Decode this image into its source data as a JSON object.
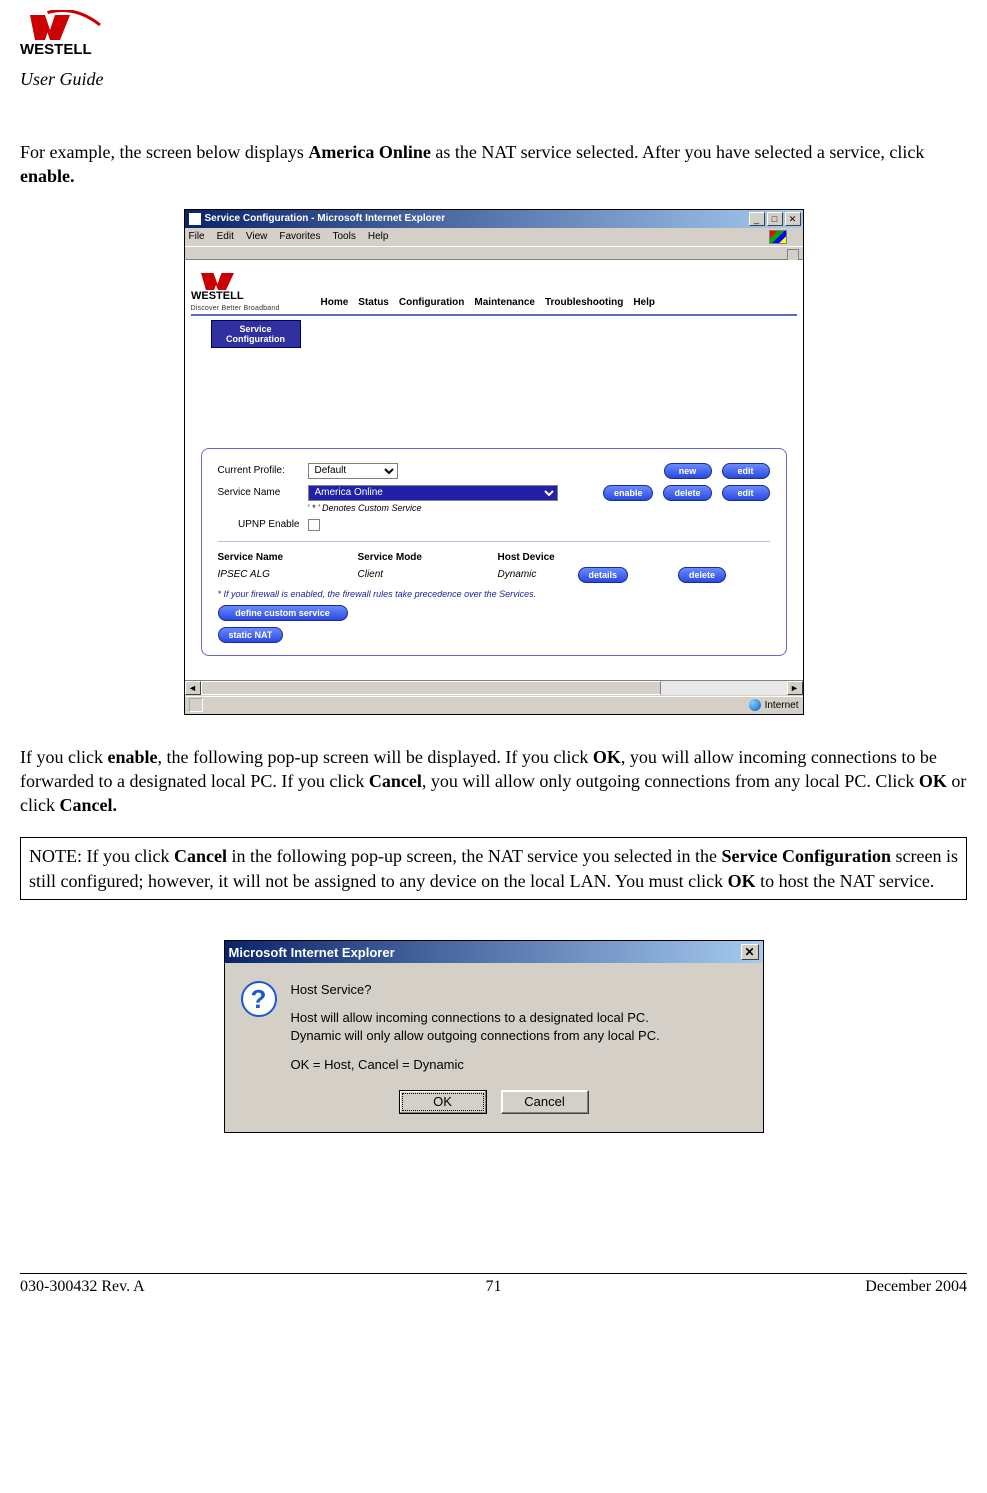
{
  "header": {
    "brand": "WESTELL",
    "user_guide": "User Guide"
  },
  "para1": {
    "pre": "For example, the screen below displays ",
    "b1": "America Online",
    "mid": " as the NAT service selected. After you have selected a service, click ",
    "b2": "enable."
  },
  "app": {
    "title": "Service Configuration - Microsoft Internet Explorer",
    "menu": {
      "file": "File",
      "edit": "Edit",
      "view": "View",
      "favorites": "Favorites",
      "tools": "Tools",
      "help": "Help"
    },
    "brand": "WESTELL",
    "tagline": "Discover Better Broadband",
    "nav": {
      "home": "Home",
      "status": "Status",
      "configuration": "Configuration",
      "maintenance": "Maintenance",
      "troubleshooting": "Troubleshooting",
      "help": "Help"
    },
    "tab": {
      "line1": "Service",
      "line2": "Configuration"
    },
    "profile_label": "Current Profile:",
    "profile_value": "Default",
    "btn_new": "new",
    "btn_edit": "edit",
    "service_label": "Service Name",
    "service_value": "America Online",
    "custom_note": "' * ' Denotes Custom Service",
    "btn_enable": "enable",
    "btn_delete": "delete",
    "btn_edit2": "edit",
    "upnp_label": "UPNP Enable",
    "th1": "Service Name",
    "th2": "Service Mode",
    "th3": "Host Device",
    "td1": "IPSEC ALG",
    "td2": "Client",
    "td3": "Dynamic",
    "btn_details": "details",
    "btn_delete2": "delete",
    "fw_note": "* If your firewall is enabled, the firewall rules take precedence over the Services.",
    "btn_define": "define custom service",
    "btn_static": "static NAT",
    "status_internet": "Internet"
  },
  "para2": {
    "t1": "If you click ",
    "b1": "enable",
    "t2": ", the following pop-up screen will be displayed. If you click ",
    "b2": "OK",
    "t3": ", you will allow incoming connections to be forwarded to a designated local PC. If you click ",
    "b3": "Cancel",
    "t4": ", you will allow only outgoing connections from any local PC. Click ",
    "b4": "OK",
    "t5": " or click ",
    "b5": "Cancel."
  },
  "note": {
    "t1": "NOTE: If you click ",
    "b1": "Cancel",
    "t2": " in the following pop-up screen, the NAT service you selected in the ",
    "b2": "Service Configuration",
    "t3": " screen is still configured; however, it will not be assigned to any device on the local LAN. You must click ",
    "b3": "OK",
    "t4": " to host the NAT service."
  },
  "dialog": {
    "title": "Microsoft Internet Explorer",
    "line1": "Host Service?",
    "line2": "Host will allow incoming connections to a designated local PC.",
    "line3": "Dynamic will only allow outgoing connections from any local PC.",
    "line4": "OK = Host, Cancel = Dynamic",
    "ok": "OK",
    "cancel": "Cancel"
  },
  "footer": {
    "left": "030-300432 Rev. A",
    "center": "71",
    "right": "December 2004"
  }
}
